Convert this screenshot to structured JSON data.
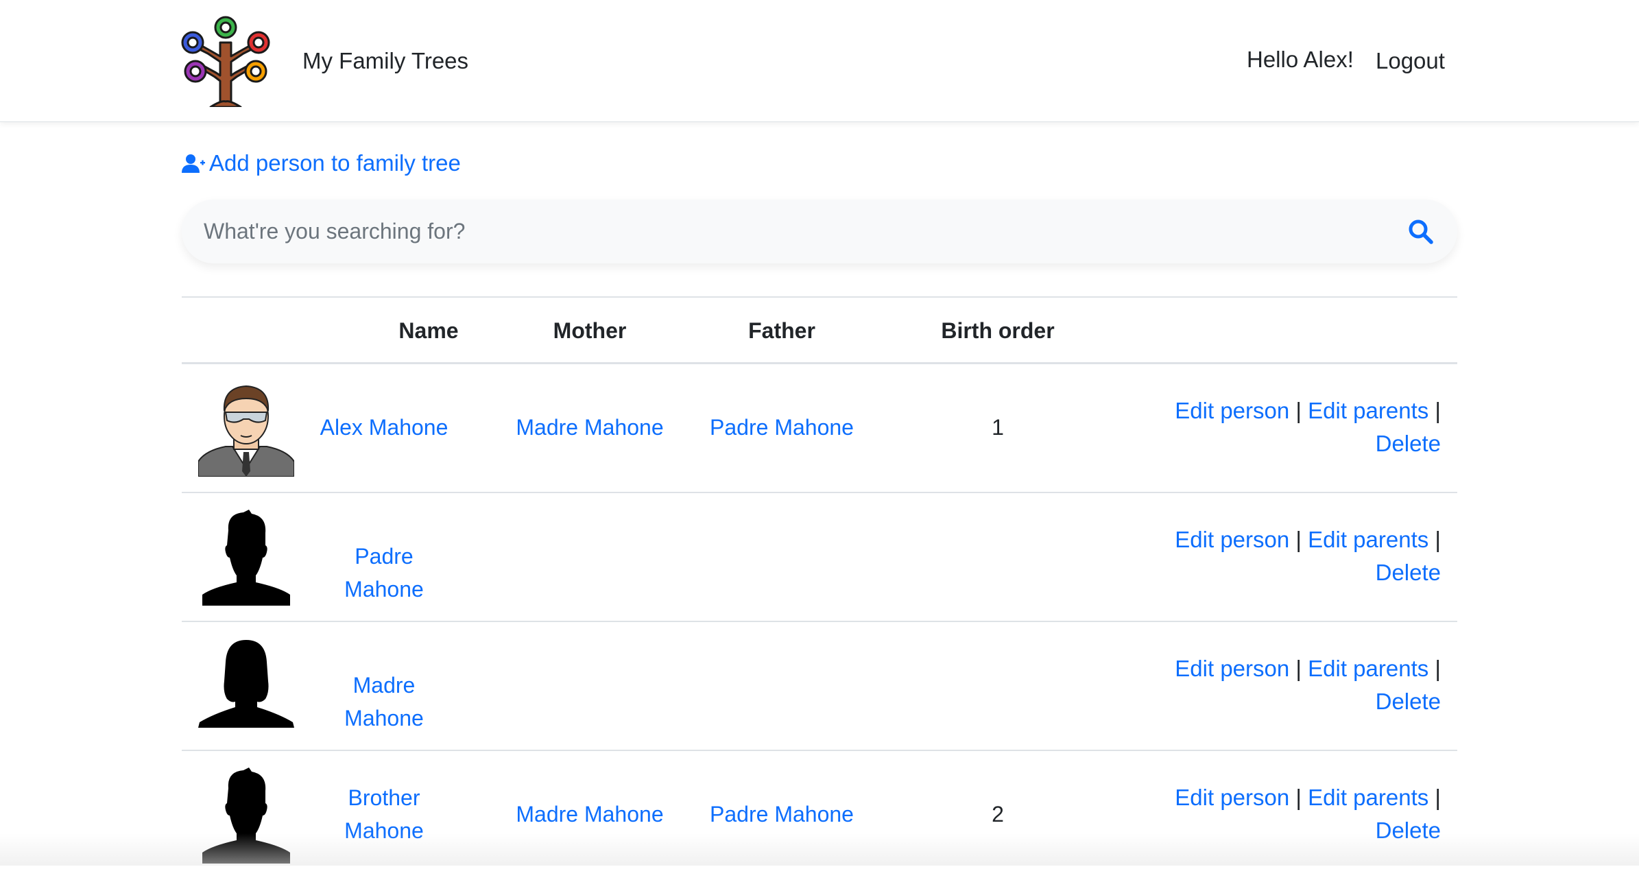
{
  "header": {
    "brand_title": "My Family Trees",
    "greeting": "Hello Alex!",
    "logout_label": "Logout"
  },
  "add_person": {
    "label": "Add person to family tree",
    "icon": "user-plus-icon"
  },
  "search": {
    "placeholder": "What're you searching for?",
    "value": "",
    "icon": "search-icon"
  },
  "table": {
    "headers": {
      "photo": "",
      "name": "Name",
      "mother": "Mother",
      "father": "Father",
      "birth_order": "Birth order",
      "actions": ""
    },
    "action_labels": {
      "edit_person": "Edit person",
      "edit_parents": "Edit parents",
      "delete": "Delete",
      "separator": "|"
    },
    "rows": [
      {
        "avatar": "cartoon-man-sunglasses",
        "name": "Alex Mahone",
        "mother": "Madre Mahone",
        "father": "Padre Mahone",
        "birth_order": "1"
      },
      {
        "avatar": "male-silhouette",
        "name": "Padre Mahone",
        "mother": "",
        "father": "",
        "birth_order": ""
      },
      {
        "avatar": "female-silhouette",
        "name": "Madre Mahone",
        "mother": "",
        "father": "",
        "birth_order": ""
      },
      {
        "avatar": "male-silhouette",
        "name_line1": "Brother",
        "name_line2": "Mahone",
        "mother": "Madre Mahone",
        "father": "Padre Mahone",
        "birth_order": "2"
      }
    ]
  },
  "colors": {
    "link": "#0d6efd",
    "text": "#212529",
    "border": "#dee2e6",
    "search_bg": "#f8f9fa"
  }
}
